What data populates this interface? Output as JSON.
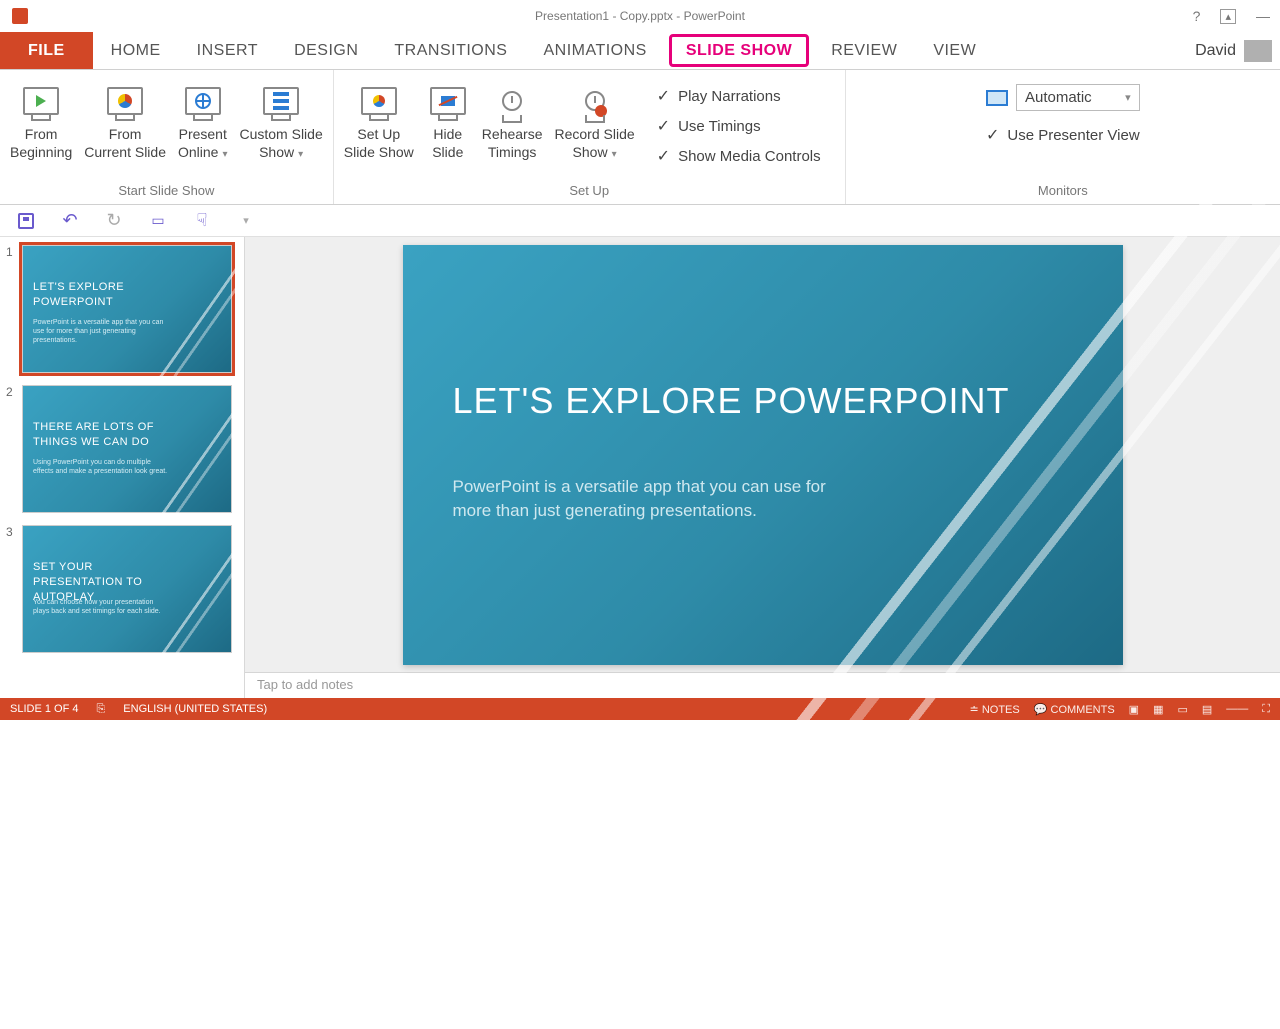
{
  "title_bar": {
    "doc_title": "Presentation1 - Copy.pptx - PowerPoint"
  },
  "tabs": {
    "file": "FILE",
    "items": [
      "HOME",
      "INSERT",
      "DESIGN",
      "TRANSITIONS",
      "ANIMATIONS",
      "SLIDE SHOW",
      "REVIEW",
      "VIEW"
    ],
    "active_index": 5,
    "user": "David"
  },
  "ribbon": {
    "start_group": {
      "label": "Start Slide Show",
      "from_beginning": "From\nBeginning",
      "from_current": "From\nCurrent Slide",
      "present_online": "Present\nOnline",
      "custom": "Custom Slide\nShow"
    },
    "setup_group": {
      "label": "Set Up",
      "setup": "Set Up\nSlide Show",
      "hide": "Hide\nSlide",
      "rehearse": "Rehearse\nTimings",
      "record": "Record Slide\nShow",
      "play_narrations": "Play Narrations",
      "use_timings": "Use Timings",
      "show_media": "Show Media Controls"
    },
    "monitors_group": {
      "label": "Monitors",
      "auto": "Automatic",
      "presenter_view": "Use Presenter View"
    }
  },
  "thumbs": [
    {
      "num": "1",
      "title": "LET'S EXPLORE POWERPOINT",
      "sub": "PowerPoint is a versatile app that you can use for more than just generating presentations."
    },
    {
      "num": "2",
      "title": "THERE ARE LOTS OF THINGS WE CAN DO",
      "sub": "Using PowerPoint you can do multiple effects and make a presentation look great."
    },
    {
      "num": "3",
      "title": "SET YOUR PRESENTATION TO AUTOPLAY",
      "sub": "You can choose how your presentation plays back and set timings for each slide."
    }
  ],
  "slide": {
    "title": "LET'S EXPLORE POWERPOINT",
    "body": "PowerPoint is a versatile app that you can use for more than just generating presentations."
  },
  "notes_placeholder": "Tap to add notes",
  "status": {
    "slide_count": "SLIDE 1 OF 4",
    "lang": "ENGLISH (UNITED STATES)",
    "notes": "NOTES",
    "comments": "COMMENTS"
  }
}
